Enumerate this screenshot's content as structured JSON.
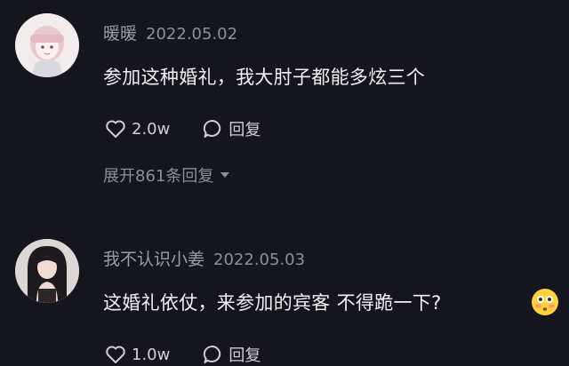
{
  "comments": [
    {
      "username": "暖暖",
      "timestamp": "2022.05.02",
      "text": "参加这种婚礼，我大肘子都能多炫三个",
      "likes": "2.0w",
      "reply_label": "回复",
      "expand_label": "展开861条回复",
      "avatar_icon": "cartoon-girl-avatar-icon"
    },
    {
      "username": "我不认识小姜",
      "timestamp": "2022.05.03",
      "text": "这婚礼依仗，来参加的宾客 不得跪一下?",
      "likes": "1.0w",
      "reply_label": "回复",
      "emoji_icon": "flushed-face-emoji-icon",
      "avatar_icon": "photo-avatar-icon"
    }
  ],
  "colors": {
    "background": "#15151d",
    "primary_text": "#f0f0f3",
    "secondary_text": "#8e8e97"
  }
}
